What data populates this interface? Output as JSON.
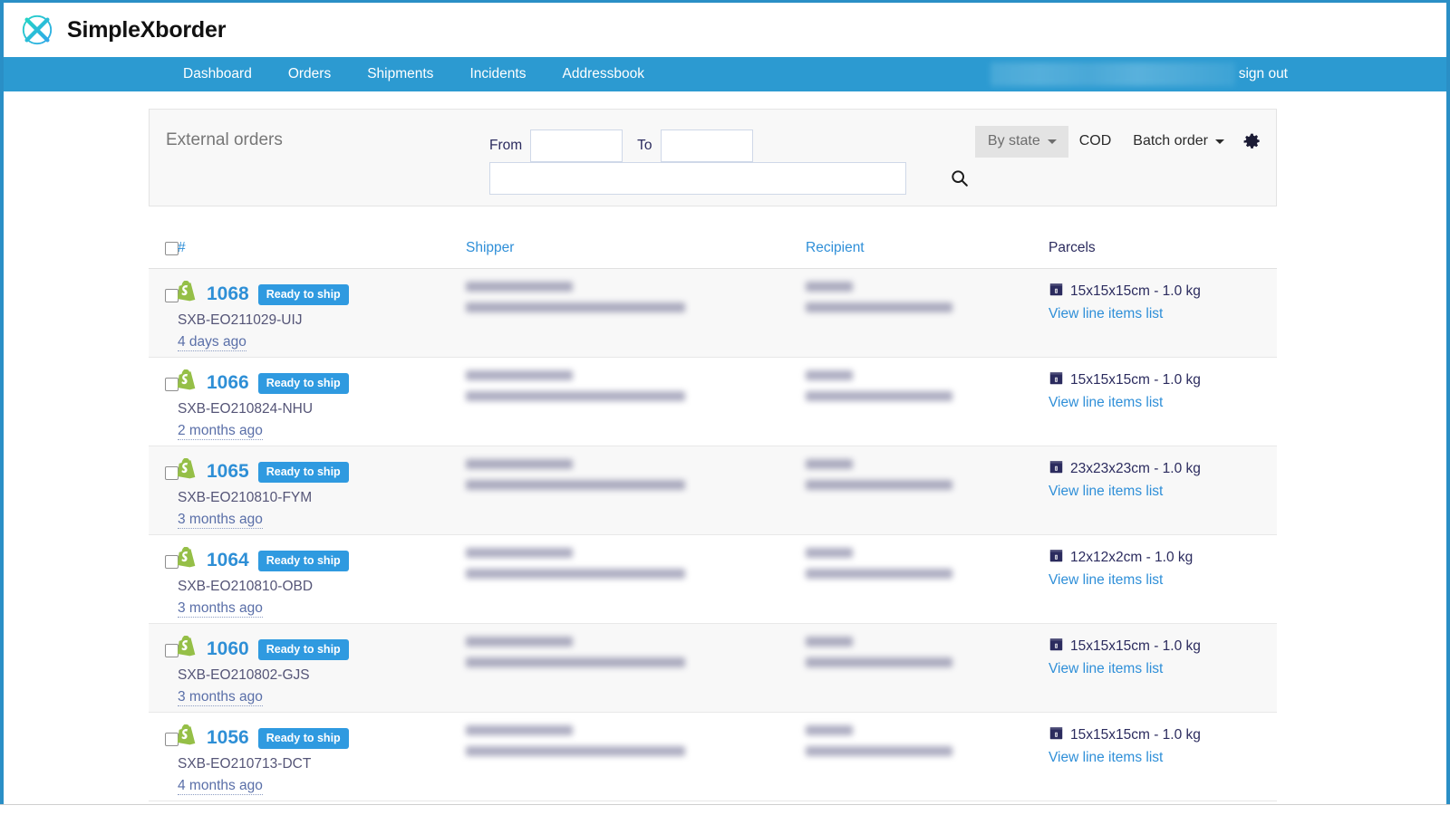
{
  "brand": {
    "name": "SimpleXborder",
    "logo_icon": "x-circle-logo"
  },
  "nav": {
    "items": [
      {
        "label": "Dashboard"
      },
      {
        "label": "Orders"
      },
      {
        "label": "Shipments"
      },
      {
        "label": "Incidents"
      },
      {
        "label": "Addressbook"
      }
    ],
    "user_label": "",
    "sign_out_label": "sign out",
    "bar_color": "#2c9ad1"
  },
  "filters": {
    "title": "External orders",
    "from_label": "From",
    "from_value": "",
    "to_label": "To",
    "to_value": "",
    "search_value": "",
    "search_placeholder": "",
    "search_icon": "search-icon",
    "by_state_label": "By state",
    "cod_label": "COD",
    "batch_order_label": "Batch order",
    "settings_icon": "gear-icon"
  },
  "table": {
    "headers": {
      "number": "#",
      "shipper": "Shipper",
      "recipient": "Recipient",
      "parcels": "Parcels"
    },
    "rows": [
      {
        "order_number": "1068",
        "status": "Ready to ship",
        "reference": "SXB-EO211029-UIJ",
        "age": "4 days ago",
        "source_icon": "shopify-icon",
        "parcel": "15x15x15cm - 1.0 kg",
        "parcel_icon": "box-icon",
        "line_items_label": "View line items list"
      },
      {
        "order_number": "1066",
        "status": "Ready to ship",
        "reference": "SXB-EO210824-NHU",
        "age": "2 months ago",
        "source_icon": "shopify-icon",
        "parcel": "15x15x15cm - 1.0 kg",
        "parcel_icon": "box-icon",
        "line_items_label": "View line items list"
      },
      {
        "order_number": "1065",
        "status": "Ready to ship",
        "reference": "SXB-EO210810-FYM",
        "age": "3 months ago",
        "source_icon": "shopify-icon",
        "parcel": "23x23x23cm - 1.0 kg",
        "parcel_icon": "box-icon",
        "line_items_label": "View line items list"
      },
      {
        "order_number": "1064",
        "status": "Ready to ship",
        "reference": "SXB-EO210810-OBD",
        "age": "3 months ago",
        "source_icon": "shopify-icon",
        "parcel": "12x12x2cm - 1.0 kg",
        "parcel_icon": "box-icon",
        "line_items_label": "View line items list"
      },
      {
        "order_number": "1060",
        "status": "Ready to ship",
        "reference": "SXB-EO210802-GJS",
        "age": "3 months ago",
        "source_icon": "shopify-icon",
        "parcel": "15x15x15cm - 1.0 kg",
        "parcel_icon": "box-icon",
        "line_items_label": "View line items list"
      },
      {
        "order_number": "1056",
        "status": "Ready to ship",
        "reference": "SXB-EO210713-DCT",
        "age": "4 months ago",
        "source_icon": "shopify-icon",
        "parcel": "15x15x15cm - 1.0 kg",
        "parcel_icon": "box-icon",
        "line_items_label": "View line items list"
      }
    ]
  },
  "colors": {
    "accent_blue": "#2f9ae0",
    "nav_blue": "#2c9ad1",
    "link_blue": "#2f8fd8",
    "navy_text": "#2b2b5e",
    "badge_blue": "#2f9ae0"
  }
}
